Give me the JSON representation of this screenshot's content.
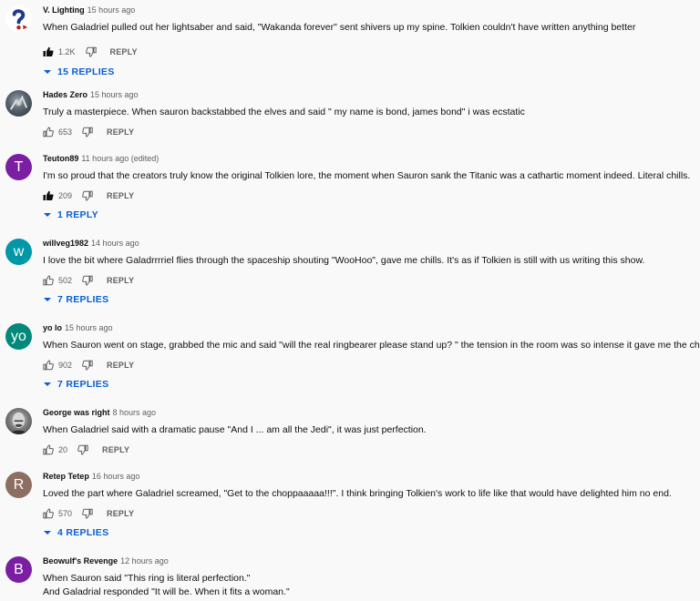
{
  "comments": [
    {
      "author": "V. Lighting",
      "time": "15 hours ago",
      "avatar_text": "",
      "avatar_kind": "question-mark",
      "text": [
        "When Galadriel pulled out her lightsaber and said, \"Wakanda forever\" sent shivers up my spine. Tolkien couldn't have written anything better"
      ],
      "likes": "1.2K",
      "liked": true,
      "reply_label": "REPLY",
      "replies_label": "15 REPLIES"
    },
    {
      "author": "Hades Zero",
      "time": "15 hours ago",
      "avatar_text": "",
      "avatar_kind": "photo",
      "text": [
        "Truly a masterpiece. When sauron backstabbed the elves and said \" my name is bond, james bond\" i was ecstatic"
      ],
      "likes": "653",
      "liked": false,
      "reply_label": "REPLY",
      "replies_label": ""
    },
    {
      "author": "Teuton89",
      "time": "11 hours ago (edited)",
      "avatar_text": "T",
      "avatar_color": "#7b1fa2",
      "text": [
        "I'm so proud that the creators truly know the original Tolkien lore, the moment when Sauron sank the Titanic was a cathartic moment indeed. Literal chills."
      ],
      "likes": "209",
      "liked": true,
      "reply_label": "REPLY",
      "replies_label": "1 REPLY"
    },
    {
      "author": "willveg1982",
      "time": "14 hours ago",
      "avatar_text": "w",
      "avatar_color": "#0097a7",
      "text": [
        "I love the bit where Galadrrrriel flies through the spaceship shouting \"WooHoo\", gave me chills. It's as if Tolkien is still with us writing this show."
      ],
      "likes": "502",
      "liked": false,
      "reply_label": "REPLY",
      "replies_label": "7 REPLIES"
    },
    {
      "author": "yo lo",
      "time": "15 hours ago",
      "avatar_text": "yo",
      "avatar_color": "#00897b",
      "text": [
        "When Sauron went on stage, grabbed the mic and said \"will the real ringbearer please stand up? \" the tension in the room was so intense it gave me the chills!"
      ],
      "likes": "902",
      "liked": false,
      "reply_label": "REPLY",
      "replies_label": "7 REPLIES"
    },
    {
      "author": "George was right",
      "time": "8 hours ago",
      "avatar_text": "",
      "avatar_kind": "photo-bw",
      "text": [
        "When Galadriel said with a dramatic pause  \"And I ... am all the Jedi\", it was just perfection."
      ],
      "likes": "20",
      "liked": false,
      "reply_label": "REPLY",
      "replies_label": ""
    },
    {
      "author": "Retep Tetep",
      "time": "16 hours ago",
      "avatar_text": "R",
      "avatar_color": "#8d6e63",
      "text": [
        "Loved the part where Galadriel screamed, \"Get to the choppaaaaa!!!\". I think bringing Tolkien's work to life like that would have delighted him no end."
      ],
      "likes": "570",
      "liked": false,
      "reply_label": "REPLY",
      "replies_label": "4 REPLIES"
    },
    {
      "author": "Beowulf's Revenge",
      "time": "12 hours ago",
      "avatar_text": "B",
      "avatar_color": "#7b1fa2",
      "text": [
        "When Sauron said \"This ring is literal perfection.\"",
        "And Galadrial responded \"It will be. When it fits a woman.\""
      ],
      "likes": "",
      "liked": false,
      "reply_label": "",
      "replies_label": ""
    }
  ]
}
